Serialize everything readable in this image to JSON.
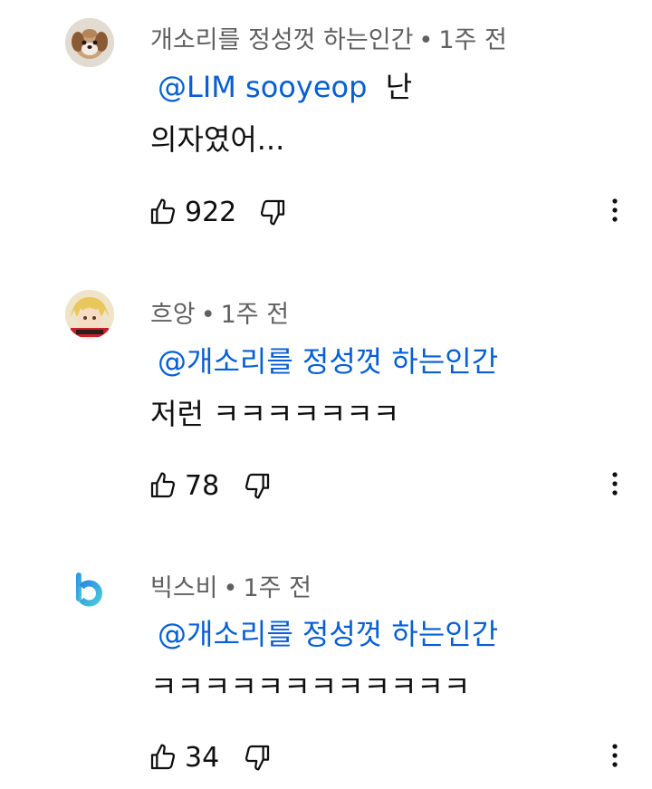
{
  "comments": [
    {
      "author": "개소리를 정성껏 하는인간",
      "separator": "•",
      "time": "1주 전",
      "mention": "@LIM sooyeop",
      "line1": "난",
      "line2": "의자였어...",
      "likes": "922",
      "avatar": "puppy-avatar"
    },
    {
      "author": "흐앙",
      "separator": "•",
      "time": "1주 전",
      "mention": "@개소리를 정성껏 하는인간",
      "line1": "",
      "line2": "저런 ㅋㅋㅋㅋㅋㅋㅋ",
      "likes": "78",
      "avatar": "anime-character-avatar"
    },
    {
      "author": "빅스비",
      "separator": "•",
      "time": "1주 전",
      "mention": "@개소리를 정성껏 하는인간",
      "line1": "",
      "line2": "ㅋㅋㅋㅋㅋㅋㅋㅋㅋㅋㅋㅋ",
      "likes": "34",
      "avatar": "bixby-logo-avatar"
    }
  ],
  "icons": {
    "like": "thumbs-up-icon",
    "dislike": "thumbs-down-icon",
    "more": "more-vert-icon"
  },
  "colors": {
    "mention": "#065fd4",
    "meta": "#606060",
    "text": "#0f0f0f"
  }
}
